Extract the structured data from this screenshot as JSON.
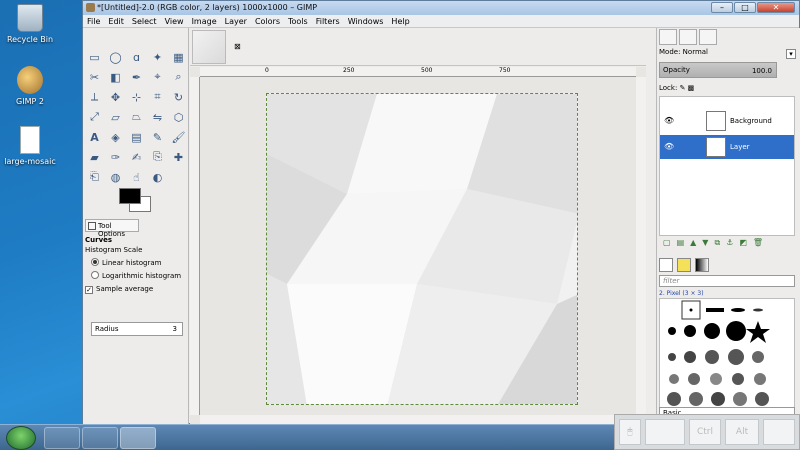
{
  "desktop": {
    "icons": [
      {
        "label": "Recycle Bin",
        "icon": "recycle-bin-icon"
      },
      {
        "label": "GIMP 2",
        "icon": "gimp-icon"
      },
      {
        "label": "large-mosaic",
        "icon": "document-icon"
      }
    ]
  },
  "window": {
    "title": "*[Untitled]-2.0 (RGB color, 2 layers) 1000x1000 – GIMP",
    "buttons": {
      "minimize": "–",
      "maximize": "□",
      "close": "✕"
    }
  },
  "menu": [
    "File",
    "Edit",
    "Select",
    "View",
    "Image",
    "Layer",
    "Colors",
    "Tools",
    "Filters",
    "Windows",
    "Help"
  ],
  "tool_options": {
    "tab_label": "Tool Options",
    "tool_name": "Curves",
    "histogram_scale_label": "Histogram Scale",
    "linear_label": "Linear histogram",
    "log_label": "Logarithmic histogram",
    "sample_average_label": "Sample average",
    "radius_label": "Radius",
    "radius_value": "3"
  },
  "image_tab": {
    "close": "⊠"
  },
  "ruler": {
    "ticks": [
      "0",
      "250",
      "500",
      "750"
    ]
  },
  "layers_panel": {
    "mode_label": "Mode:",
    "mode_value": "Normal",
    "opacity_label": "Opacity",
    "opacity_value": "100.0",
    "lock_label": "Lock:",
    "layers": [
      {
        "name": "Background",
        "selected": false
      },
      {
        "name": "Layer",
        "selected": true
      }
    ]
  },
  "brushes_panel": {
    "filter_placeholder": "filter",
    "brush_name": "2. Pixel (3 × 3)",
    "basic_label": "Basic."
  },
  "osk": {
    "ctrl": "Ctrl",
    "alt": "Alt"
  }
}
